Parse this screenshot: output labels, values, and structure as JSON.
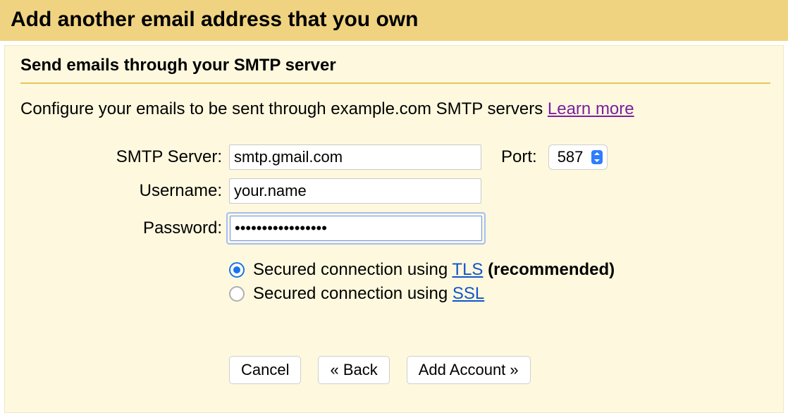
{
  "banner_title": "Add another email address that you own",
  "section_title": "Send emails through your SMTP server",
  "description_prefix": "Configure your emails to be sent through example.com SMTP servers ",
  "learn_more": "Learn more",
  "labels": {
    "smtp": "SMTP Server:",
    "port": "Port:",
    "username": "Username:",
    "password": "Password:"
  },
  "fields": {
    "smtp": "smtp.gmail.com",
    "port": "587",
    "username": "your.name",
    "password": "•••••••••••••••••"
  },
  "security": {
    "tls_prefix": "Secured connection using ",
    "tls_link": "TLS",
    "tls_suffix": " (recommended)",
    "ssl_prefix": "Secured connection using ",
    "ssl_link": "SSL",
    "selected": "tls"
  },
  "buttons": {
    "cancel": "Cancel",
    "back": "« Back",
    "add": "Add Account »"
  }
}
